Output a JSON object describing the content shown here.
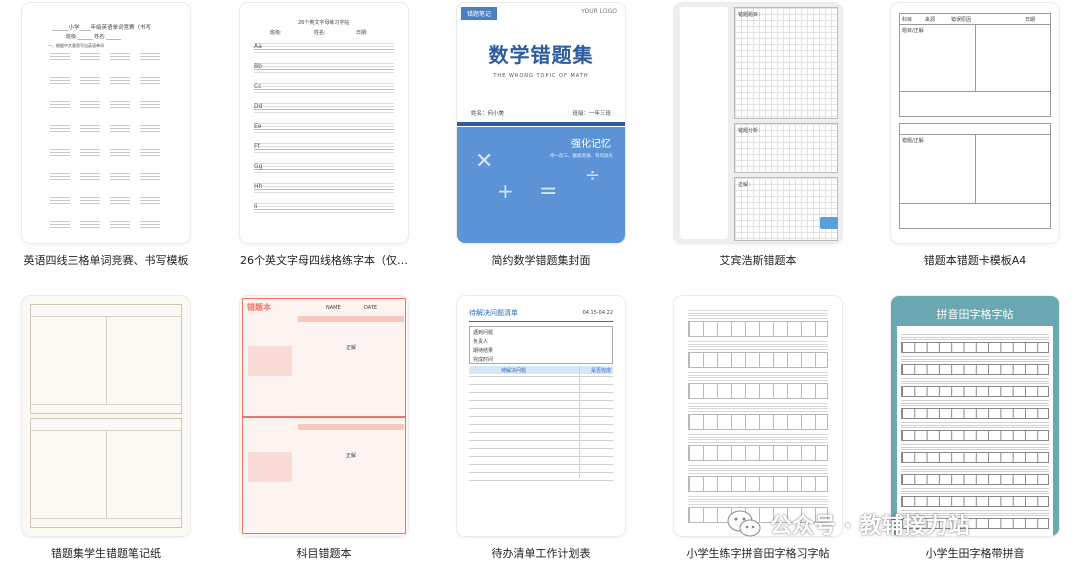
{
  "cards": [
    {
      "caption": "英语四线三格单词竞赛、书写模板",
      "inner_title": "______小学____年级英语单词竞赛（书写",
      "inner_fields": "班级:______  姓名:______",
      "inner_instruction": "一、根据中文意思写出英语单词"
    },
    {
      "caption": "26个英文字母四线格练字本（仅打...",
      "inner_title": "26个英文字母练习字帖",
      "inner_fields": [
        "班级:",
        "姓名:",
        "日期:"
      ],
      "letters": [
        "Aa",
        "Bb",
        "Cc",
        "Dd",
        "Ee",
        "Ff",
        "Gg",
        "Hh",
        "Ii"
      ]
    },
    {
      "caption": "简约数学错题集封面",
      "tag": "错题笔记",
      "logo": "YOUR LOGO",
      "title": "数学错题集",
      "subtitle": "THE WRONG TOPIC OF MATH",
      "name_label": "姓名：何小美",
      "grade_label": "班级：一年三班",
      "banner": "强化记忆",
      "motto": "举一反三、触类旁通、有的放矢"
    },
    {
      "caption": "艾宾浩斯错题本",
      "labels": [
        "错题题目：",
        "错题分析：",
        "正解："
      ]
    },
    {
      "caption": "错题本错题卡模板A4",
      "fields": [
        "科目",
        "来源",
        "错误原因",
        "日期"
      ],
      "labels": [
        "题目/正解",
        "错题/正解"
      ]
    },
    {
      "caption": "错题集学生错题笔记纸"
    },
    {
      "caption": "科目错题本",
      "title": "错题本",
      "fields": [
        "NAME",
        "DATE"
      ],
      "center_label": "正解"
    },
    {
      "caption": "待办清单工作计划表",
      "title": "待解决问题清单",
      "date": "04.15-04.22",
      "rows": [
        "遇到问题",
        "负责人",
        "期待结果",
        "完成时间"
      ],
      "col_headers": [
        "待解决问题",
        "是否完成"
      ]
    },
    {
      "caption": "小学生练字拼音田字格习字帖"
    },
    {
      "caption": "小学生田字格带拼音",
      "header_title": "拼音田字格字帖"
    }
  ],
  "watermark": {
    "text": "公众号 · 教辅接力站",
    "icon": "wechat-icon"
  },
  "colors": {
    "math_blue": "#4a7fc0",
    "math_light": "#5b93d6",
    "subject_pink": "#e8786a",
    "todo_blue": "#2a6bb8",
    "teal": "#6aa7b0"
  }
}
